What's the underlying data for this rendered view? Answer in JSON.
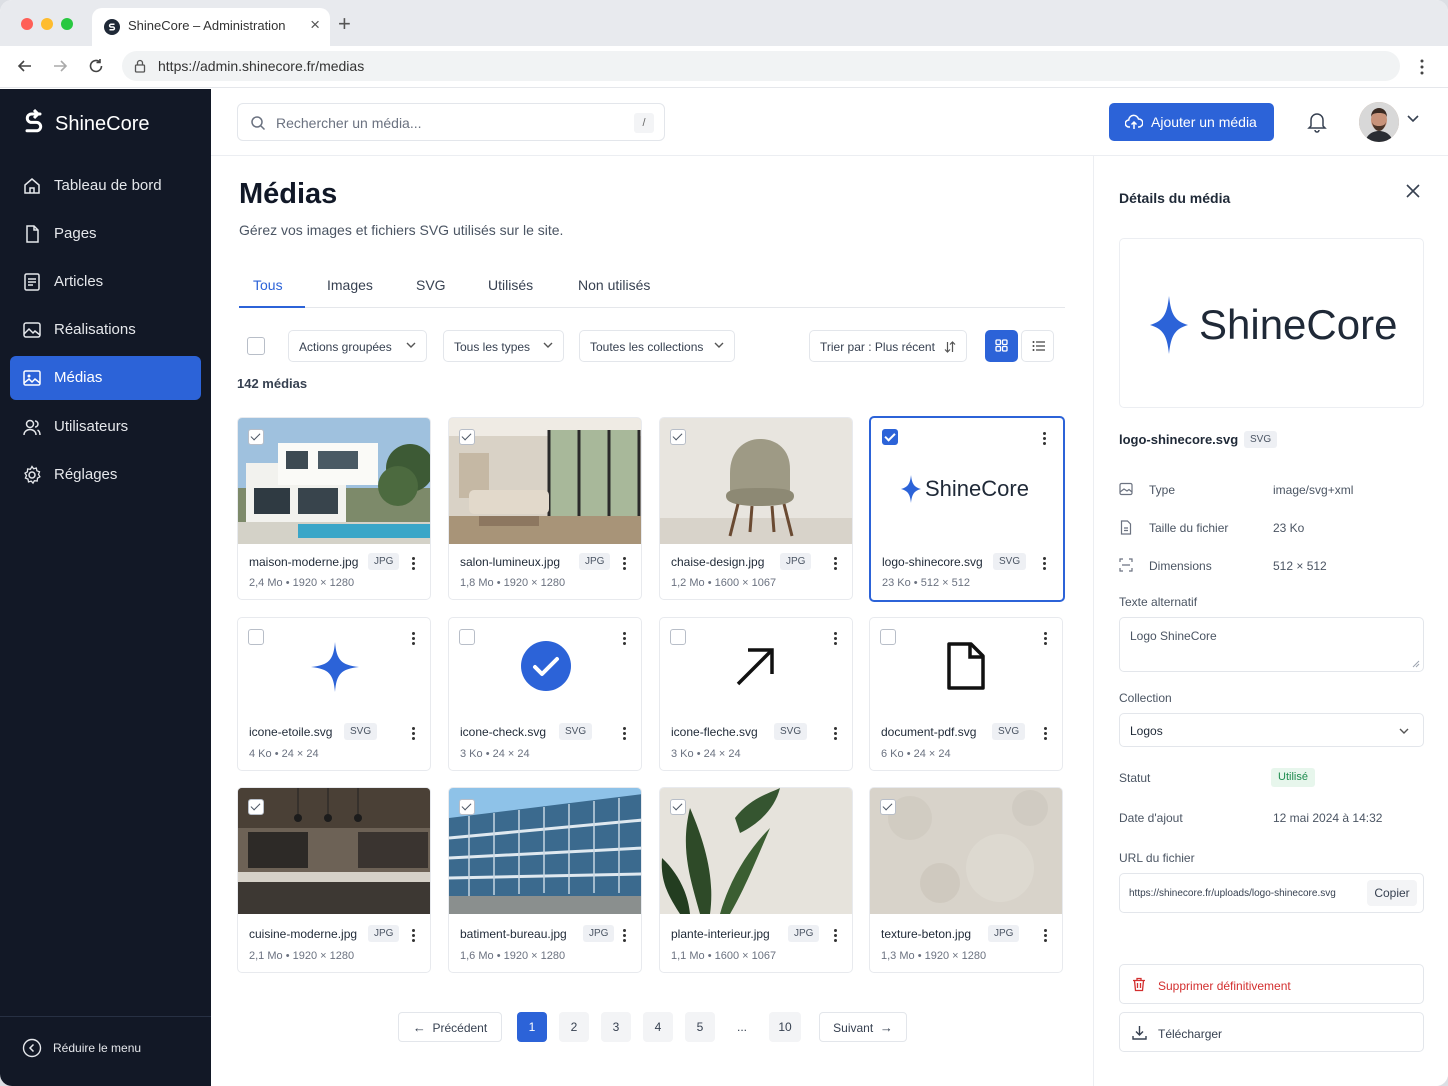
{
  "browser": {
    "tab_title": "ShineCore – Administration",
    "url": "https://admin.shinecore.fr/medias"
  },
  "sidebar": {
    "brand": "ShineCore",
    "items": [
      {
        "label": "Tableau de bord",
        "icon": "home-icon"
      },
      {
        "label": "Pages",
        "icon": "file-icon"
      },
      {
        "label": "Articles",
        "icon": "article-icon"
      },
      {
        "label": "Réalisations",
        "icon": "image-gallery-icon"
      },
      {
        "label": "Médias",
        "icon": "image-icon",
        "active": true
      },
      {
        "label": "Utilisateurs",
        "icon": "users-icon"
      },
      {
        "label": "Réglages",
        "icon": "gear-icon"
      }
    ],
    "collapse_label": "Réduire le menu"
  },
  "topbar": {
    "search_placeholder": "Rechercher un média...",
    "search_shortcut": "/",
    "add_button": "Ajouter un média"
  },
  "main": {
    "title": "Médias",
    "subtitle": "Gérez vos images et fichiers SVG utilisés sur le site.",
    "tabs": [
      "Tous",
      "Images",
      "SVG",
      "Utilisés",
      "Non utilisés"
    ],
    "active_tab": "Tous",
    "filters": {
      "bulk": "Actions groupées",
      "types": "Tous les types",
      "collections": "Toutes les collections",
      "sort": "Trier par : Plus récent"
    },
    "count": "142 médias",
    "media": [
      {
        "name": "maison-moderne.jpg",
        "type": "JPG",
        "size": "2,4 Mo",
        "dims": "1920 × 1280",
        "checked": true
      },
      {
        "name": "salon-lumineux.jpg",
        "type": "JPG",
        "size": "1,8 Mo",
        "dims": "1920 × 1280",
        "checked": true
      },
      {
        "name": "chaise-design.jpg",
        "type": "JPG",
        "size": "1,2 Mo",
        "dims": "1600 × 1067",
        "checked": true
      },
      {
        "name": "logo-shinecore.svg",
        "type": "SVG",
        "size": "23 Ko",
        "dims": "512 × 512",
        "checked": true,
        "selected": true,
        "preview_text": "ShineCore"
      },
      {
        "name": "icone-etoile.svg",
        "type": "SVG",
        "size": "4 Ko",
        "dims": "24 × 24",
        "checked": false
      },
      {
        "name": "icone-check.svg",
        "type": "SVG",
        "size": "3 Ko",
        "dims": "24 × 24",
        "checked": false
      },
      {
        "name": "icone-fleche.svg",
        "type": "SVG",
        "size": "3 Ko",
        "dims": "24 × 24",
        "checked": false
      },
      {
        "name": "document-pdf.svg",
        "type": "SVG",
        "size": "6 Ko",
        "dims": "24 × 24",
        "checked": false
      },
      {
        "name": "cuisine-moderne.jpg",
        "type": "JPG",
        "size": "2,1 Mo",
        "dims": "1920 × 1280",
        "checked": true
      },
      {
        "name": "batiment-bureau.jpg",
        "type": "JPG",
        "size": "1,6 Mo",
        "dims": "1920 × 1280",
        "checked": true
      },
      {
        "name": "plante-interieur.jpg",
        "type": "JPG",
        "size": "1,1 Mo",
        "dims": "1600 × 1067",
        "checked": true
      },
      {
        "name": "texture-beton.jpg",
        "type": "JPG",
        "size": "1,3 Mo",
        "dims": "1920 × 1280",
        "checked": true
      }
    ],
    "pagination": {
      "prev": "Précédent",
      "next": "Suivant",
      "pages": [
        "1",
        "2",
        "3",
        "4",
        "5",
        "...",
        "10"
      ],
      "current": "1"
    }
  },
  "details": {
    "title": "Détails du média",
    "preview_text": "ShineCore",
    "file_name": "logo-shinecore.svg",
    "file_badge": "SVG",
    "rows": [
      {
        "label": "Type",
        "value": "image/svg+xml"
      },
      {
        "label": "Taille du fichier",
        "value": "23 Ko"
      },
      {
        "label": "Dimensions",
        "value": "512 × 512"
      }
    ],
    "alt_label": "Texte alternatif",
    "alt_value": "Logo ShineCore",
    "collection_label": "Collection",
    "collection_value": "Logos",
    "status_label": "Statut",
    "status_value": "Utilisé",
    "date_label": "Date d'ajout",
    "date_value": "12 mai 2024 à 14:32",
    "url_label": "URL du fichier",
    "url_value": "https://shinecore.fr/uploads/logo-shinecore.svg",
    "copy_button": "Copier",
    "delete_button": "Supprimer définitivement",
    "download_button": "Télécharger"
  },
  "colors": {
    "accent": "#2c63d8",
    "sidebar_bg": "#121826",
    "danger": "#d32f2f",
    "success_bg": "#e7f6ec"
  }
}
